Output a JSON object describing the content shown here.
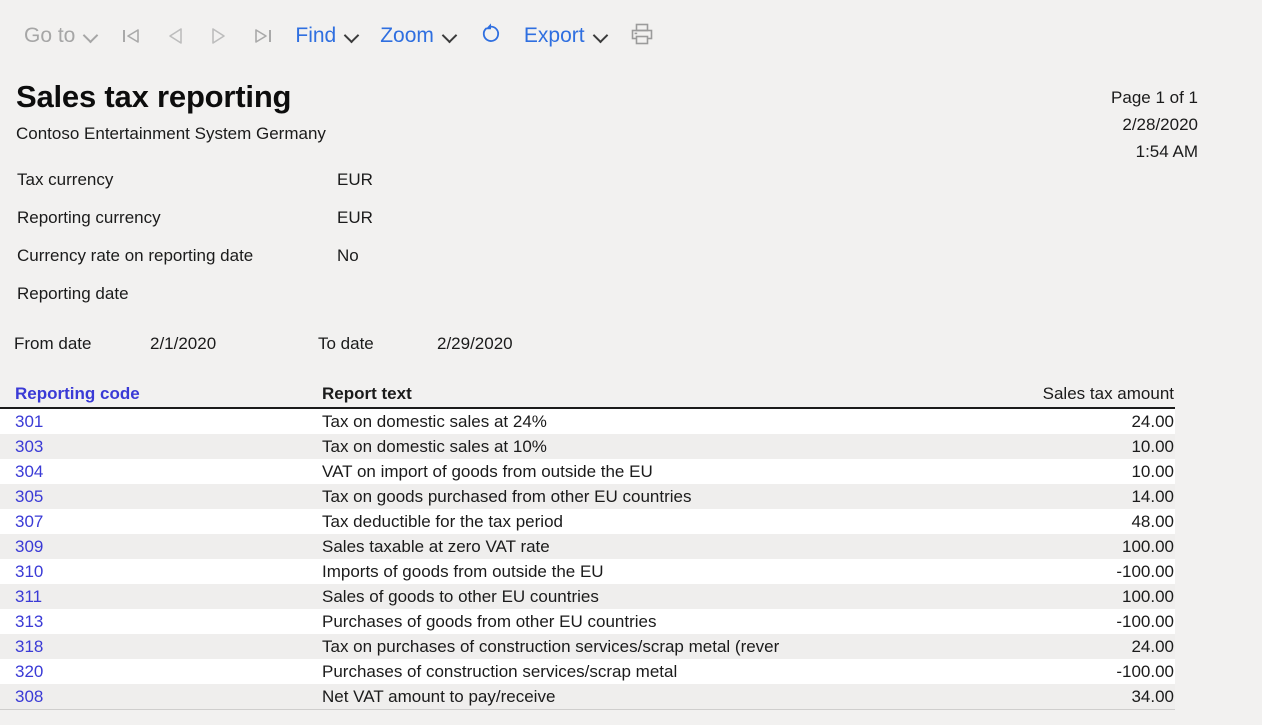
{
  "toolbar": {
    "goto_label": "Go to",
    "first_page_icon": "first-page-icon",
    "prev_page_icon": "previous-page-icon",
    "next_page_icon": "next-page-icon",
    "last_page_icon": "last-page-icon",
    "find_label": "Find",
    "zoom_label": "Zoom",
    "refresh_icon": "refresh-icon",
    "export_label": "Export",
    "print_icon": "print-icon",
    "link_color": "#2f6fe0",
    "disabled_color": "#a6a6a6"
  },
  "report": {
    "title": "Sales tax reporting",
    "subtitle": "Contoso Entertainment System Germany",
    "page_info": "Page 1 of 1",
    "date": "2/28/2020",
    "time": "1:54 AM",
    "params": [
      {
        "label": "Tax currency",
        "value": "EUR"
      },
      {
        "label": "Reporting currency",
        "value": "EUR"
      },
      {
        "label": "Currency rate on reporting date",
        "value": "No"
      },
      {
        "label": "Reporting date",
        "value": ""
      }
    ],
    "date_range": {
      "from_label": "From date",
      "from_value": "2/1/2020",
      "to_label": "To date",
      "to_value": "2/29/2020"
    },
    "table": {
      "columns": [
        "Reporting code",
        "Report text",
        "Sales tax amount"
      ],
      "rows": [
        {
          "code": "301",
          "text": "Tax on domestic sales at 24%",
          "amount": "24.00"
        },
        {
          "code": "303",
          "text": "Tax on domestic sales at 10%",
          "amount": "10.00"
        },
        {
          "code": "304",
          "text": "VAT on import of goods from outside the EU",
          "amount": "10.00"
        },
        {
          "code": "305",
          "text": "Tax on goods purchased from other EU countries",
          "amount": "14.00"
        },
        {
          "code": "307",
          "text": "Tax deductible for the tax period",
          "amount": "48.00"
        },
        {
          "code": "309",
          "text": "Sales taxable at zero VAT rate",
          "amount": "100.00"
        },
        {
          "code": "310",
          "text": "Imports of goods from outside the EU",
          "amount": "-100.00"
        },
        {
          "code": "311",
          "text": "Sales of goods to other EU countries",
          "amount": "100.00"
        },
        {
          "code": "313",
          "text": "Purchases of goods from other EU countries",
          "amount": "-100.00"
        },
        {
          "code": "318",
          "text": "Tax on purchases of construction services/scrap metal (rever",
          "amount": "24.00"
        },
        {
          "code": "320",
          "text": "Purchases of construction services/scrap metal",
          "amount": "-100.00"
        },
        {
          "code": "308",
          "text": "Net VAT amount to pay/receive",
          "amount": "34.00"
        }
      ]
    }
  }
}
